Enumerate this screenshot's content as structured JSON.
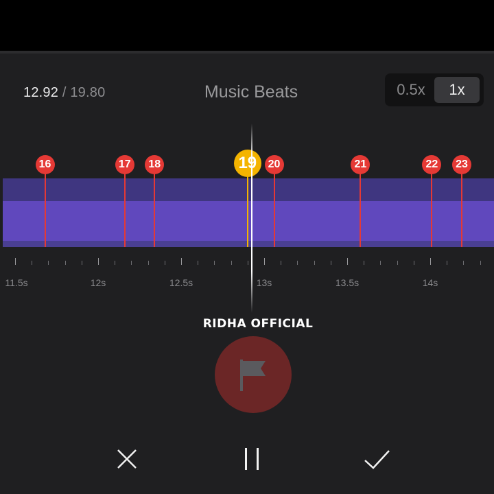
{
  "header": {
    "current_time": "12.92",
    "separator": "/",
    "total_time": "19.80",
    "title": "Music Beats",
    "speed_options": [
      "0.5x",
      "1x"
    ],
    "selected_speed": "1x"
  },
  "beats": [
    {
      "label": "16",
      "time": 11.68
    },
    {
      "label": "17",
      "time": 12.16
    },
    {
      "label": "18",
      "time": 12.34
    },
    {
      "label": "19",
      "time": 12.9,
      "active": true
    },
    {
      "label": "20",
      "time": 13.06
    },
    {
      "label": "21",
      "time": 13.58
    },
    {
      "label": "22",
      "time": 14.01
    },
    {
      "label": "23",
      "time": 14.19
    }
  ],
  "ruler": {
    "labels": [
      "11.5s",
      "12s",
      "12.5s",
      "13s",
      "13.5s",
      "14s"
    ]
  },
  "watermark": "RIDHA OFFICIAL",
  "icons": {
    "mark": "flag-icon",
    "cancel": "close-icon",
    "pause": "pause-icon",
    "confirm": "check-icon"
  },
  "colors": {
    "beat_marker": "#e53935",
    "active_beat": "#f4b400",
    "waveform": "#6048bd",
    "mark_button": "#6b2626"
  }
}
